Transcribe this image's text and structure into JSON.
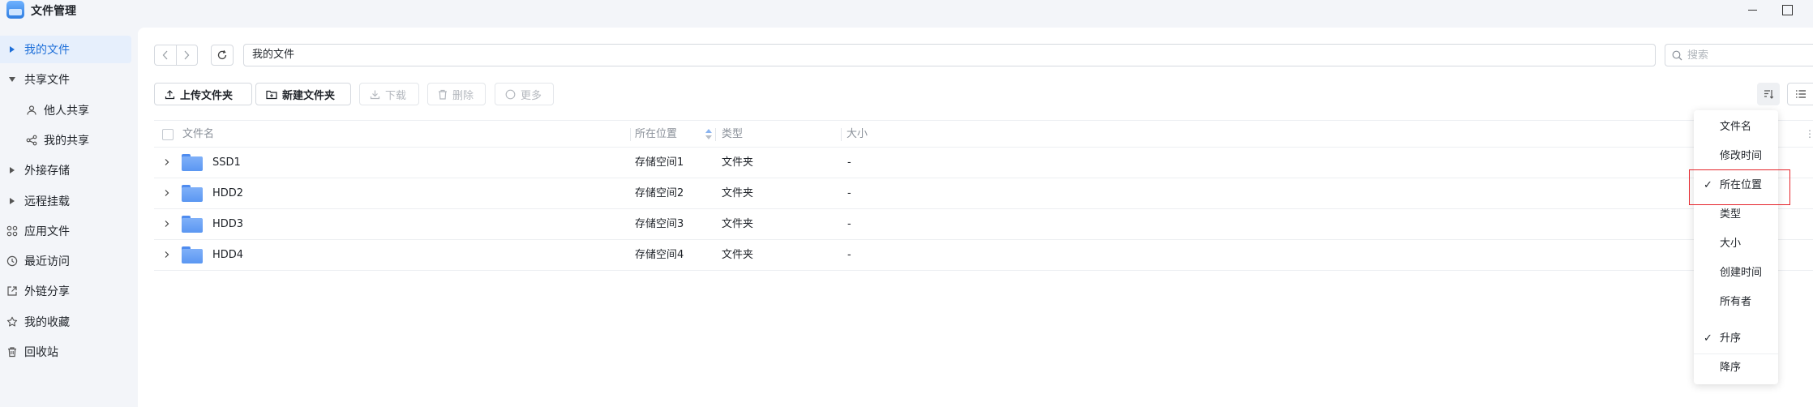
{
  "app": {
    "title": "文件管理"
  },
  "sidebar": {
    "items": [
      {
        "label": "我的文件",
        "icon": "caret-right-icon"
      },
      {
        "label": "共享文件",
        "icon": "caret-down-icon"
      },
      {
        "label": "他人共享",
        "icon": "users-icon"
      },
      {
        "label": "我的共享",
        "icon": "share-icon"
      },
      {
        "label": "外接存储",
        "icon": "caret-right-icon"
      },
      {
        "label": "远程挂载",
        "icon": "caret-right-icon"
      },
      {
        "label": "应用文件",
        "icon": "apps-icon"
      },
      {
        "label": "最近访问",
        "icon": "clock-icon"
      },
      {
        "label": "外链分享",
        "icon": "external-link-icon"
      },
      {
        "label": "我的收藏",
        "icon": "star-icon"
      },
      {
        "label": "回收站",
        "icon": "trash-icon"
      }
    ]
  },
  "path_bar": {
    "path": "我的文件"
  },
  "search": {
    "placeholder": "搜索"
  },
  "toolbar": {
    "upload": "上传文件夹",
    "new_folder": "新建文件夹",
    "download": "下载",
    "delete": "删除",
    "more": "更多"
  },
  "table": {
    "headers": {
      "name": "文件名",
      "location": "所在位置",
      "type": "类型",
      "size": "大小"
    },
    "rows": [
      {
        "name": "SSD1",
        "location": "存储空间1",
        "type": "文件夹",
        "size": "-"
      },
      {
        "name": "HDD2",
        "location": "存储空间2",
        "type": "文件夹",
        "size": "-"
      },
      {
        "name": "HDD3",
        "location": "存储空间3",
        "type": "文件夹",
        "size": "-"
      },
      {
        "name": "HDD4",
        "location": "存储空间4",
        "type": "文件夹",
        "size": "-"
      }
    ]
  },
  "sort_menu": {
    "fields": [
      "文件名",
      "修改时间",
      "所在位置",
      "类型",
      "大小",
      "创建时间",
      "所有者"
    ],
    "selected_field": "所在位置",
    "orders": [
      "升序",
      "降序"
    ],
    "selected_order": "升序",
    "check_mark": "✓"
  },
  "colors": {
    "accent": "#1e6fd9",
    "highlight": "#e5242b",
    "folder": "#5b97f2"
  }
}
